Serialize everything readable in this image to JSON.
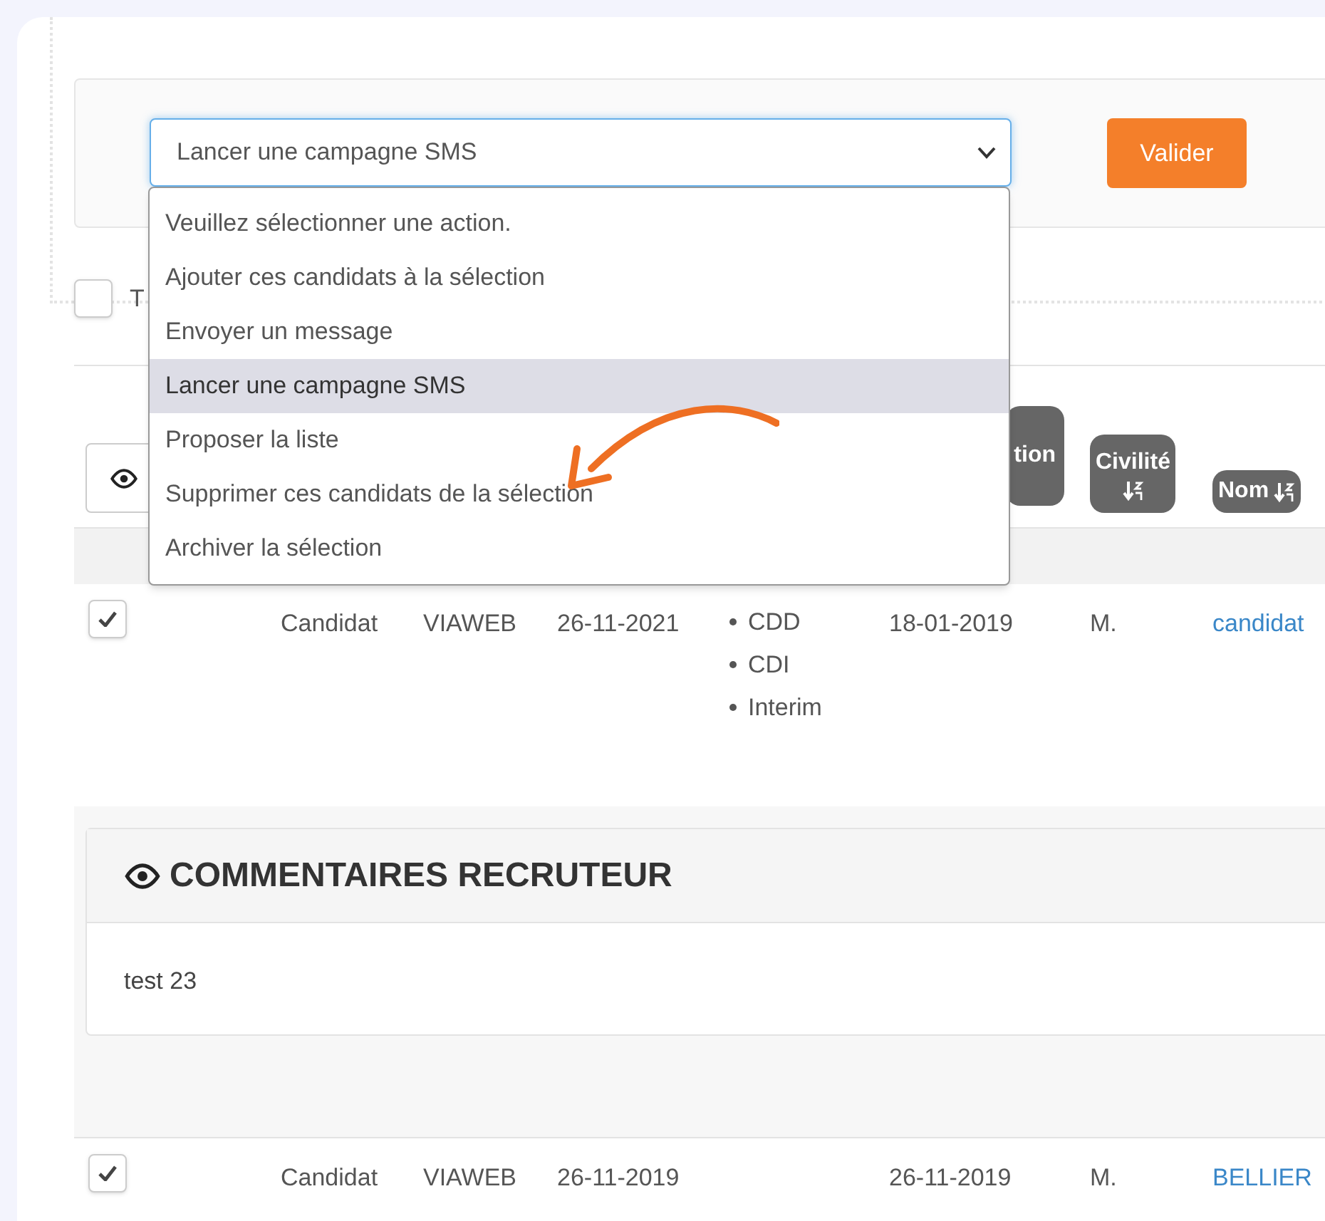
{
  "action_bar": {
    "select": {
      "value": "Lancer une campagne SMS",
      "expanded": true
    },
    "options": [
      {
        "label": "Veuillez sélectionner une action.",
        "selected": false
      },
      {
        "label": "Ajouter ces candidats à la sélection",
        "selected": false
      },
      {
        "label": "Envoyer un message",
        "selected": false
      },
      {
        "label": "Lancer une campagne SMS",
        "selected": true
      },
      {
        "label": "Proposer la liste",
        "selected": false
      },
      {
        "label": "Supprimer ces candidats de la sélection",
        "selected": false
      },
      {
        "label": "Archiver la sélection",
        "selected": false
      }
    ],
    "submit_button": "Valider"
  },
  "select_all": {
    "label": "T",
    "checked": false
  },
  "table": {
    "columns": [
      {
        "label": "tion",
        "kind": "inline",
        "sortable": false
      },
      {
        "label": "Civilité",
        "kind": "stacked",
        "sortable": true
      },
      {
        "label": "Nom",
        "kind": "inline",
        "sortable": true
      }
    ],
    "rows": [
      {
        "checked": true,
        "type": "Candidat",
        "source": "VIAWEB",
        "date": "26-11-2021",
        "contracts": [
          "CDD",
          "CDI",
          "Interim"
        ],
        "birth_date": "18-01-2019",
        "civility": "M.",
        "name": "candidat",
        "comments": {
          "title": "COMMENTAIRES RECRUTEUR",
          "text": "test 23"
        }
      },
      {
        "checked": true,
        "type": "Candidat",
        "source": "VIAWEB",
        "date": "26-11-2019",
        "birth_date": "26-11-2019",
        "civility": "M.",
        "name": "BELLIER"
      }
    ]
  }
}
